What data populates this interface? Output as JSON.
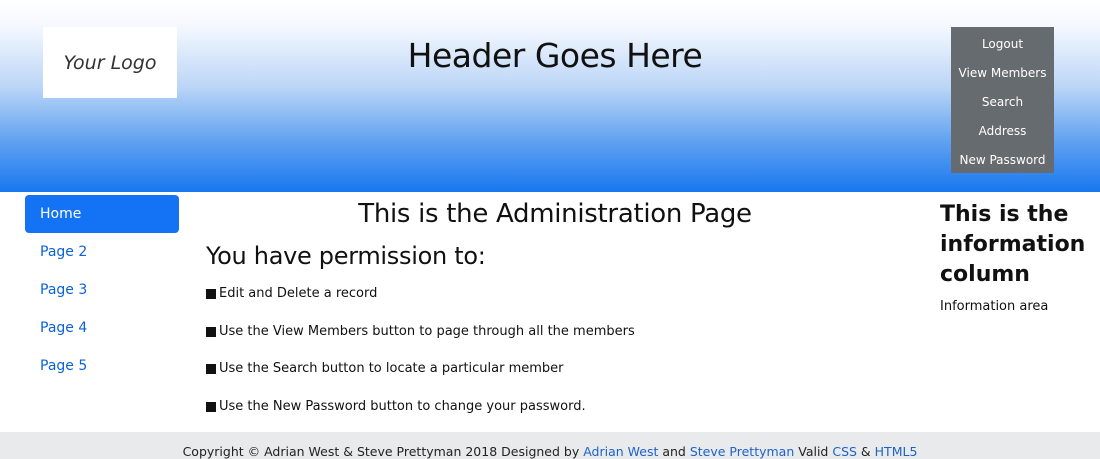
{
  "header": {
    "logo_text": "Your Logo",
    "title": "Header Goes Here",
    "menu": [
      {
        "label": "Logout"
      },
      {
        "label": "View Members"
      },
      {
        "label": "Search"
      },
      {
        "label": "Address"
      },
      {
        "label": "New Password"
      }
    ]
  },
  "sidebar": {
    "items": [
      {
        "label": "Home",
        "active": true
      },
      {
        "label": "Page 2",
        "active": false
      },
      {
        "label": "Page 3",
        "active": false
      },
      {
        "label": "Page 4",
        "active": false
      },
      {
        "label": "Page 5",
        "active": false
      }
    ]
  },
  "main": {
    "title": "This is the Administration Page",
    "permission_heading": "You have permission to:",
    "permissions": [
      {
        "text": "Edit and Delete a record"
      },
      {
        "text": "Use the View Members button to page through all the members"
      },
      {
        "text": "Use the Search button to locate a particular member"
      },
      {
        "text": "Use the New Password button to change your password."
      }
    ]
  },
  "info_column": {
    "title": "This is the information column",
    "text": "Information area"
  },
  "footer": {
    "prefix": "Copyright © Adrian West & Steve Prettyman 2018 Designed by ",
    "author1": "Adrian West",
    "and_text": " and ",
    "author2": "Steve Prettyman",
    "valid_text": " Valid ",
    "css_link": "CSS",
    "amp_text": " & ",
    "html5_link": "HTML5"
  },
  "colors": {
    "header_gradient_bottom": "#1878ef",
    "menu_background": "#666b70",
    "nav_active": "#1473f4",
    "link": "#0b62d6",
    "footer_background": "#e9eaeb"
  }
}
